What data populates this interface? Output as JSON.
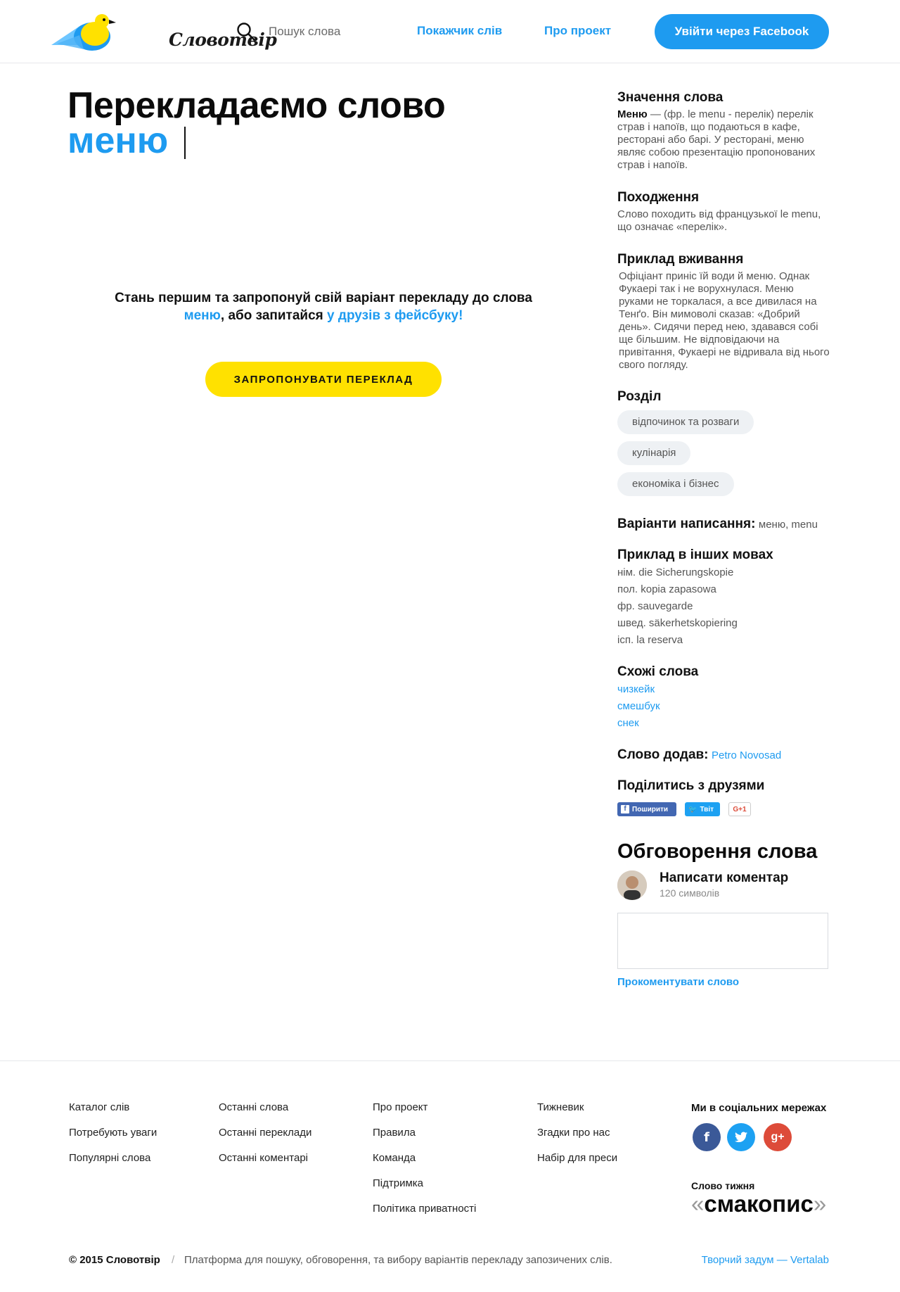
{
  "header": {
    "logo_text": "Словотвір",
    "search_placeholder": "Пошук слова",
    "nav": [
      "Покажчик слів",
      "Про проект"
    ],
    "login_label": "Увійти через Facebook"
  },
  "main": {
    "title": "Перекладаємо слово",
    "word": "меню",
    "cta_part1": "Стань першим та запропонуй свій варіант перекладу до слова",
    "cta_word": "меню",
    "cta_part2": ", або запитайся ",
    "cta_link": "у друзів з фейсбуку!",
    "suggest_button": "ЗАПРОПОНУВАТИ ПЕРЕКЛАД"
  },
  "sidebar": {
    "meaning_h": "Значення слова",
    "meaning_word": "Меню",
    "meaning_text": " — (фр. le menu - перелік) перелік страв і напоїв, що подаються в кафе, ресторані або барі. У ресторані, меню являє собою презентацію пропонованих страв і напоїв.",
    "origin_h": "Походження",
    "origin_text": "Слово походить від французької le menu, що означає «перелік».",
    "usage_h": "Приклад вживання",
    "usage_text": "Офіціант приніс їй води й меню. Однак Фукаері так і не ворухнулася. Меню руками не торкалася, а все дивилася на Тенґо. Він мимоволі сказав: «Добрий день». Сидячи перед нею, здавався собі ще більшим. Не відповідаючи на привітання, Фукаері не відривала від нього свого погляду.",
    "section_h": "Розділ",
    "tags": [
      "відпочинок та розваги",
      "кулінарія",
      "економіка і бізнес"
    ],
    "variants_h": "Варіанти написання:",
    "variants_text": "меню, menu",
    "other_langs_h": "Приклад в інших мовах",
    "other_langs": [
      "нім. die Sicherungskopie",
      "пол. kopia zapasowa",
      "фр. sauvegarde",
      "швед. säkerhetskopiering",
      "ісп. la reserva"
    ],
    "similar_h": "Схожі слова",
    "similar": [
      "чизкейк",
      "смешбук",
      "снек"
    ],
    "added_by_h": "Слово додав:",
    "added_by": "Petro Novosad",
    "share_h": "Поділитись з друзями",
    "share_fb": "Поширити",
    "share_tw": "Твіт",
    "share_gp": "G+1",
    "discussion_h": "Обговорення слова",
    "write_comment": "Написати коментар",
    "char_count": "120 символів",
    "comment_submit": "Прокоментувати слово"
  },
  "footer": {
    "col1": [
      "Каталог слів",
      "Потребують уваги",
      "Популярні слова"
    ],
    "col2": [
      "Останні слова",
      "Останні переклади",
      "Останні коментарі"
    ],
    "col3": [
      "Про проект",
      "Правила",
      "Команда",
      "Підтримка",
      "Політика приватності"
    ],
    "col4": [
      "Тижневик",
      "Згадки про нас",
      "Набір для преси"
    ],
    "social_h": "Ми в соціальних мережах",
    "word_of_week_h": "Слово тижня",
    "word_of_week": "смакопис",
    "copyright": "© 2015 Словотвір",
    "separator": "/",
    "platform": "Платформа для пошуку, обговорення, та вибору варіантів перекладу запозичених слів.",
    "credit": "Творчий задум — Vertalab"
  },
  "colors": {
    "accent": "#1e9bf0",
    "button_yellow": "#ffe100",
    "facebook": "#3b5998",
    "twitter": "#1da1f2",
    "google_plus": "#dd4b39"
  },
  "icons": {
    "logo": "bird-logo-icon",
    "search": "search-icon",
    "facebook": "facebook-icon",
    "twitter": "twitter-icon",
    "google_plus": "google-plus-icon"
  }
}
